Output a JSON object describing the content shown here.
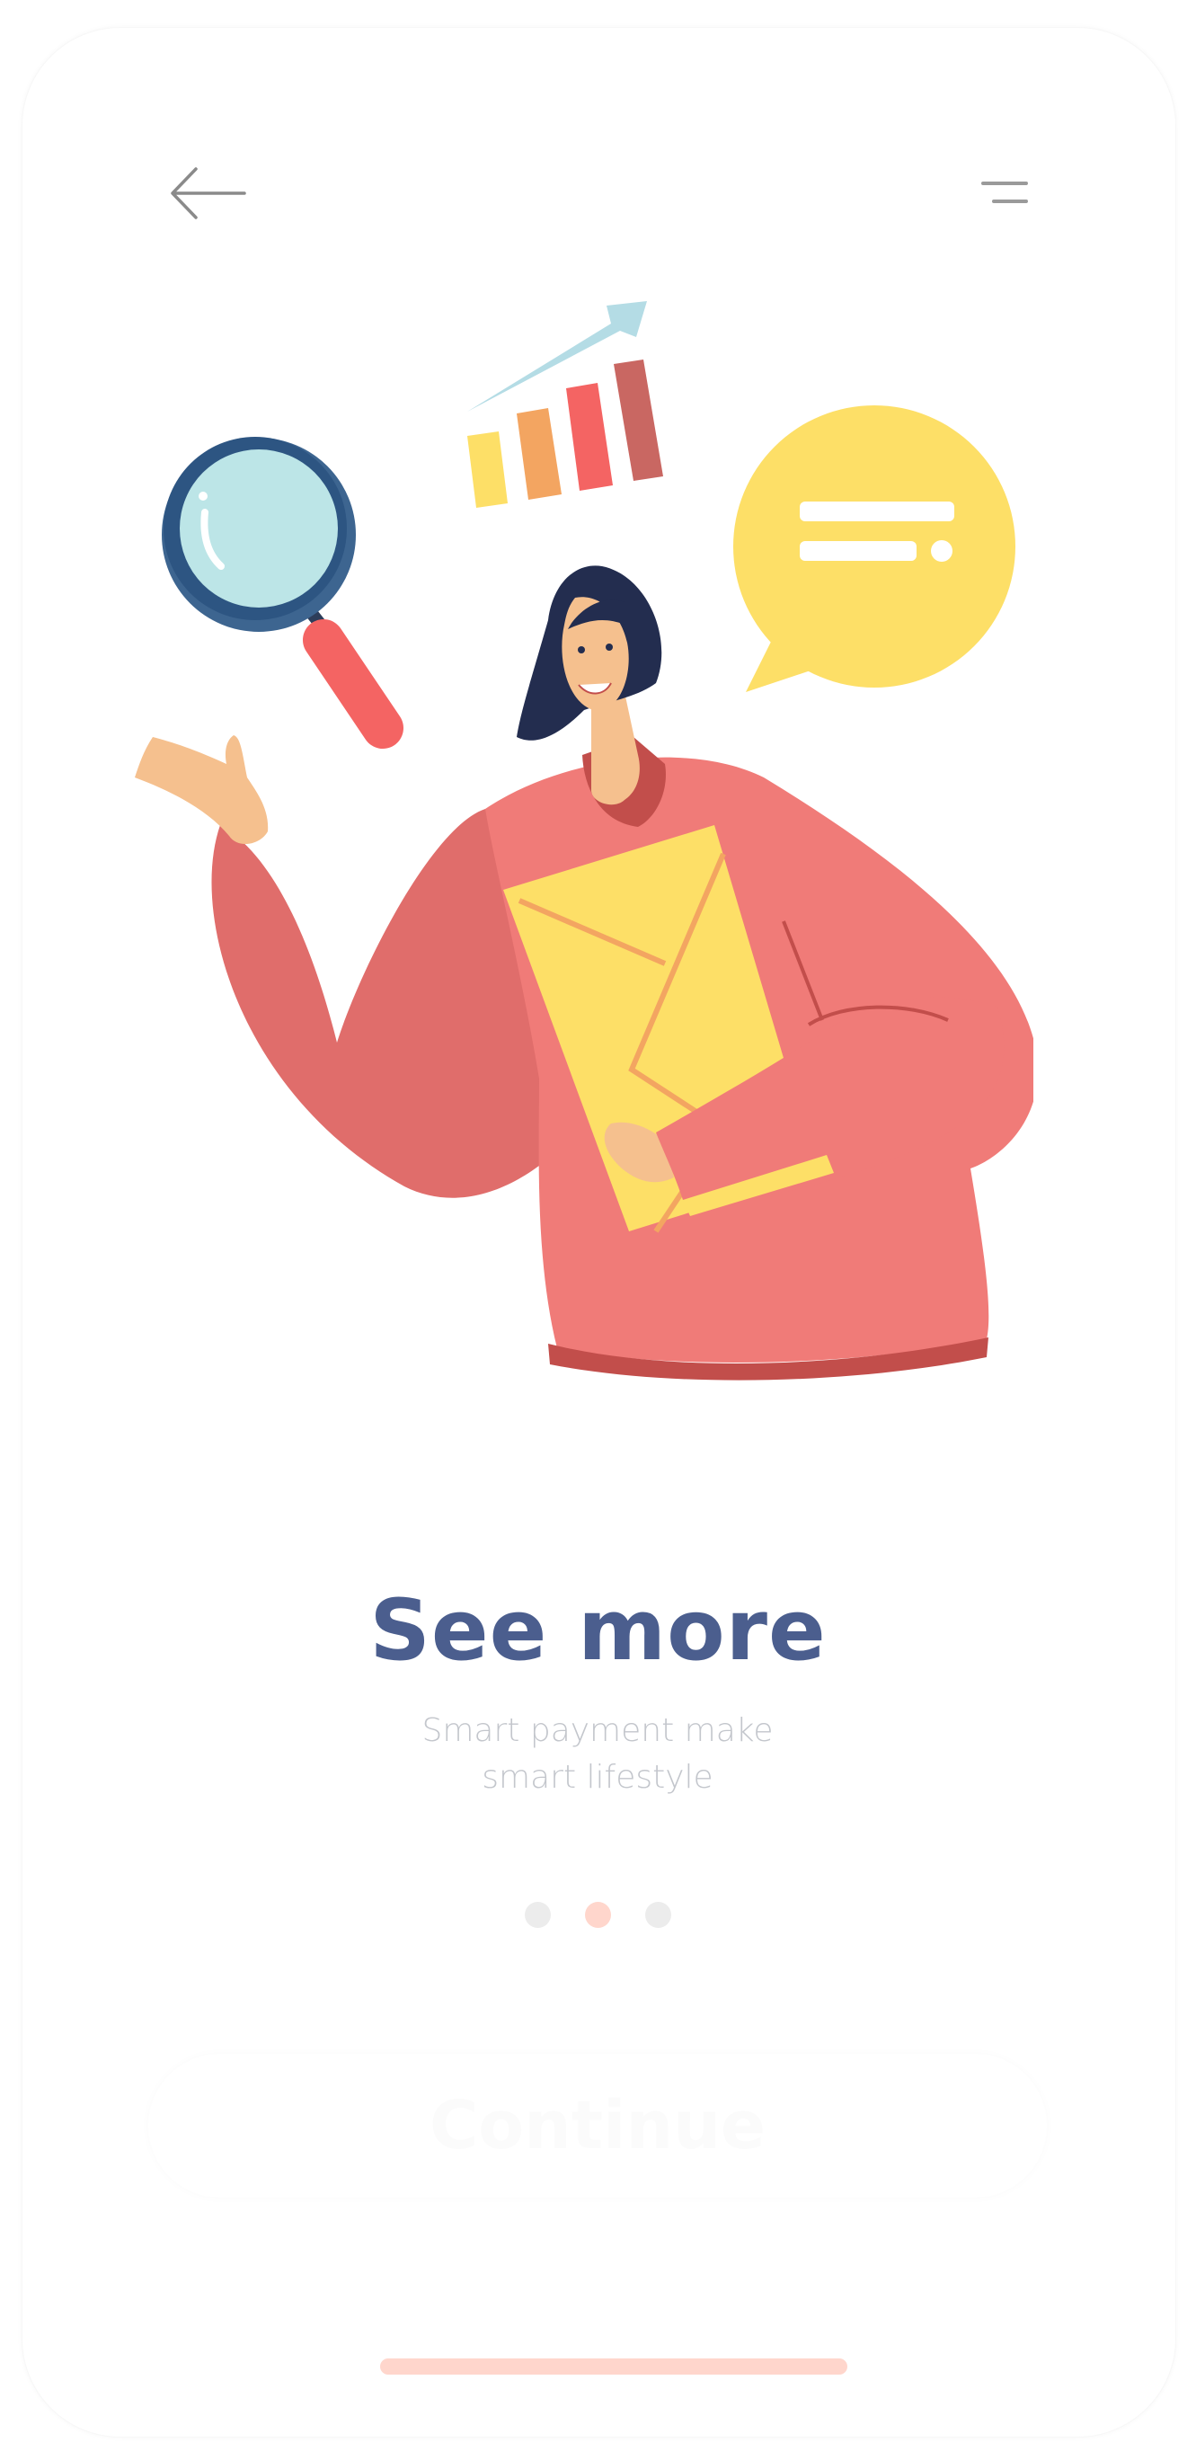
{
  "header": {
    "back_icon": "arrow-left-icon",
    "menu_icon": "menu-icon"
  },
  "illustration": {
    "subject": "woman-holding-envelope",
    "elements": [
      "magnifier-icon",
      "bar-chart-icon",
      "chat-bubble-icon"
    ]
  },
  "onboarding": {
    "title": "See more",
    "subtitle_line1": "Smart payment make",
    "subtitle_line2": "smart lifestyle",
    "page_count": 3,
    "active_page": 2
  },
  "actions": {
    "continue_label": "Continue"
  },
  "colors": {
    "title": "#4b5e8e",
    "subtitle": "#c3c6cc",
    "accent": "#ffd6cc",
    "dot_inactive": "#ececec",
    "sweater": "#f07b78",
    "envelope": "#fddf67"
  }
}
